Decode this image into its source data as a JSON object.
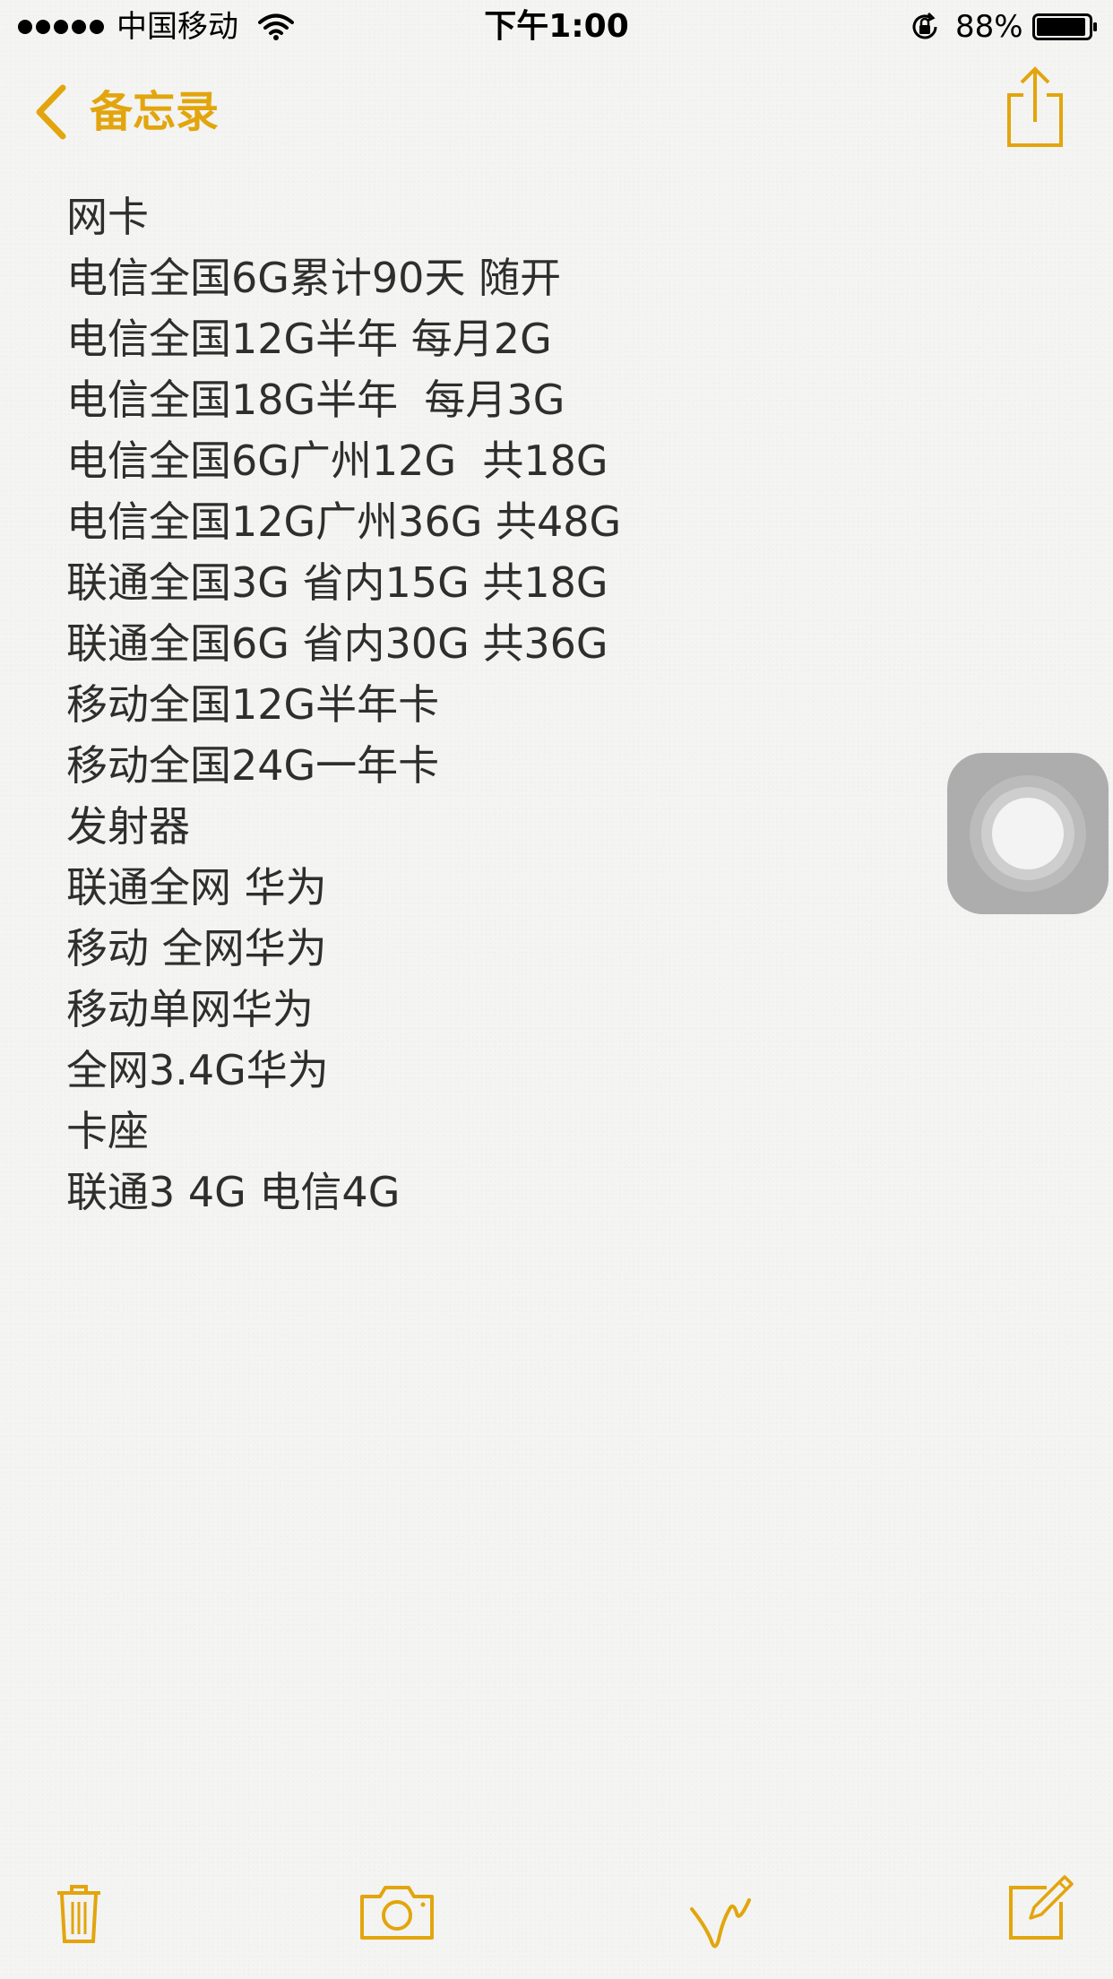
{
  "status_bar": {
    "carrier": "中国移动",
    "time": "下午1:00",
    "battery_percent": "88%"
  },
  "nav": {
    "back_label": "备忘录"
  },
  "note": {
    "lines": [
      "网卡",
      "电信全国6G累计90天 随开",
      "电信全国12G半年 每月2G",
      "电信全国18G半年  每月3G",
      "电信全国6G广州12G  共18G",
      "电信全国12G广州36G 共48G",
      "联通全国3G 省内15G 共18G",
      "联通全国6G 省内30G 共36G",
      "移动全国12G半年卡",
      "移动全国24G一年卡",
      "发射器",
      "联通全网 华为",
      "移动 全网华为",
      "移动单网华为",
      "全网3.4G华为",
      "卡座",
      "联通3 4G 电信4G"
    ]
  },
  "icons": {
    "signal": "signal-dots-icon",
    "wifi": "wifi-icon",
    "lock": "rotation-lock-icon",
    "battery": "battery-icon",
    "back": "chevron-left-icon",
    "share": "share-icon",
    "trash": "trash-icon",
    "camera": "camera-icon",
    "sketch": "sketch-icon",
    "compose": "compose-icon"
  },
  "colors": {
    "accent": "#e2a50d",
    "text": "#2e2e2e",
    "background": "#f4f4f2"
  }
}
